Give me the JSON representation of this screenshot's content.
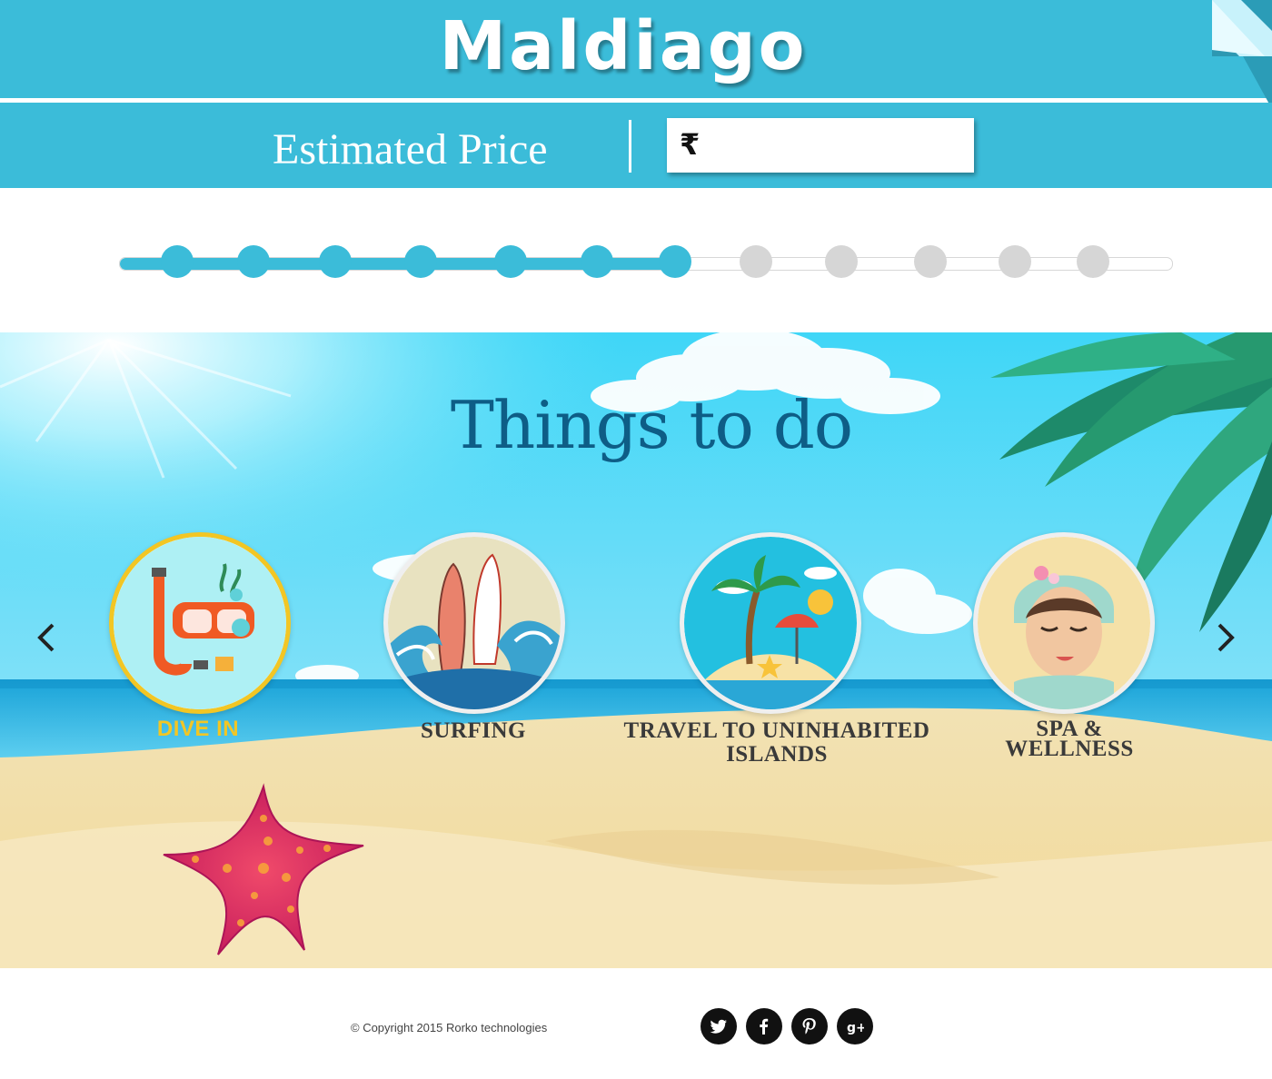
{
  "header": {
    "brand": "Maldiago",
    "price_label": "Estimated Price",
    "currency_symbol": "₹",
    "price_value": ""
  },
  "progress": {
    "total_steps": 12,
    "completed_steps": 7
  },
  "things_to_do": {
    "title": "Things to do",
    "activities": [
      {
        "label": "DIVE IN",
        "icon": "snorkel-mask-icon",
        "active": true
      },
      {
        "label": "SURFING",
        "icon": "surfboards-wave-icon",
        "active": false
      },
      {
        "label": "TRAVEL TO UNINHABITED ISLANDS",
        "icon": "palm-island-icon",
        "active": false
      },
      {
        "label": "SPA & WELLNESS",
        "icon": "spa-woman-icon",
        "active": false
      }
    ]
  },
  "footer": {
    "copyright": "© Copyright 2015 Rorko technologies",
    "social": [
      "twitter-icon",
      "facebook-icon",
      "pinterest-icon",
      "google-plus-icon"
    ]
  },
  "colors": {
    "brand_blue": "#3bbcd9",
    "active_yellow": "#f2c624",
    "title_blue": "#0e5d86",
    "inactive_step": "#d6d6d6"
  }
}
